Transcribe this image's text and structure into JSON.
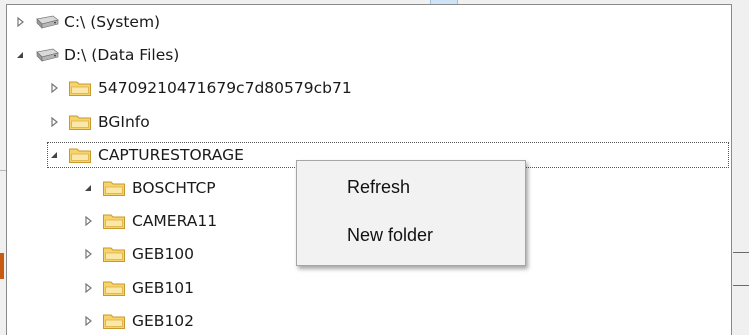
{
  "tree": {
    "nodes": [
      {
        "label": "C:\\ (System)",
        "type": "drive",
        "expanded": false,
        "level": 0
      },
      {
        "label": "D:\\ (Data Files)",
        "type": "drive",
        "expanded": true,
        "level": 0
      },
      {
        "label": "54709210471679c7d80579cb71",
        "type": "folder",
        "expanded": false,
        "level": 1
      },
      {
        "label": "BGInfo",
        "type": "folder",
        "expanded": false,
        "level": 1
      },
      {
        "label": "CAPTURESTORAGE",
        "type": "folder",
        "expanded": true,
        "level": 1,
        "selected": true
      },
      {
        "label": "BOSCHTCP",
        "type": "folder",
        "expanded": true,
        "level": 2
      },
      {
        "label": "CAMERA11",
        "type": "folder",
        "expanded": false,
        "level": 2
      },
      {
        "label": "GEB100",
        "type": "folder",
        "expanded": false,
        "level": 2
      },
      {
        "label": "GEB101",
        "type": "folder",
        "expanded": false,
        "level": 2
      },
      {
        "label": "GEB102",
        "type": "folder",
        "expanded": false,
        "level": 2
      }
    ]
  },
  "context_menu": {
    "items": [
      {
        "label": "Refresh"
      },
      {
        "label": "New folder"
      }
    ]
  },
  "icons": {
    "drive": "hard-drive-icon",
    "folder": "folder-icon",
    "collapsed": "triangle-right-icon",
    "expanded": "triangle-down-right-icon"
  },
  "colors": {
    "folder_fill": "#f7d36a",
    "folder_stroke": "#c89a2a",
    "menu_bg": "#f2f2f2",
    "accent_orange": "#c85a12"
  }
}
